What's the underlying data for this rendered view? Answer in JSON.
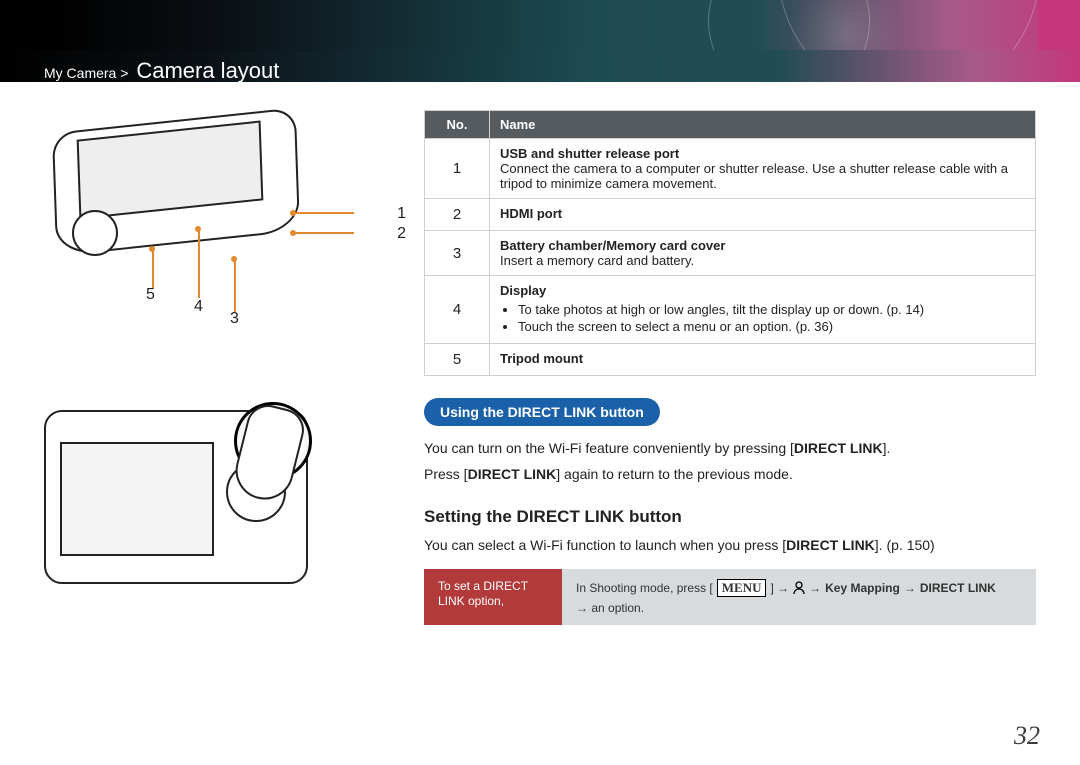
{
  "breadcrumb": {
    "parent": "My Camera",
    "sep": ">",
    "section": "Camera layout"
  },
  "diagram1_callouts": [
    "1",
    "2",
    "3",
    "4",
    "5"
  ],
  "table": {
    "headers": {
      "no": "No.",
      "name": "Name"
    },
    "rows": [
      {
        "no": "1",
        "name": "USB and shutter release port",
        "desc": "Connect the camera to a computer or shutter release. Use a shutter release cable with a tripod to minimize camera movement."
      },
      {
        "no": "2",
        "name": "HDMI port",
        "desc": ""
      },
      {
        "no": "3",
        "name": "Battery chamber/Memory card cover",
        "desc": "Insert a memory card and battery."
      },
      {
        "no": "4",
        "name": "Display",
        "bullets": [
          "To take photos at high or low angles, tilt the display up or down. (p. 14)",
          "Touch the screen to select a menu or an option. (p. 36)"
        ]
      },
      {
        "no": "5",
        "name": "Tripod mount",
        "desc": ""
      }
    ]
  },
  "pill_using": "Using the DIRECT LINK button",
  "using_text_1a": "You can turn on the Wi-Fi feature conveniently by pressing [",
  "using_text_1b": "DIRECT LINK",
  "using_text_1c": "].",
  "using_text_2a": "Press [",
  "using_text_2b": "DIRECT LINK",
  "using_text_2c": "] again to return to the previous mode.",
  "setting_heading": "Setting the DIRECT LINK button",
  "setting_text_a": "You can select a Wi-Fi function to launch when you press [",
  "setting_text_b": "DIRECT LINK",
  "setting_text_c": "]. (p. 150)",
  "instruction": {
    "red": "To set a DIRECT LINK option,",
    "grey_pre": "In Shooting mode, press [",
    "menu": "MENU",
    "grey_mid1": "] →",
    "grey_mid2": "→",
    "key_mapping": "Key Mapping",
    "grey_mid3": "→",
    "direct_link": "DIRECT LINK",
    "grey_post": "→ an option."
  },
  "page_number": "32"
}
